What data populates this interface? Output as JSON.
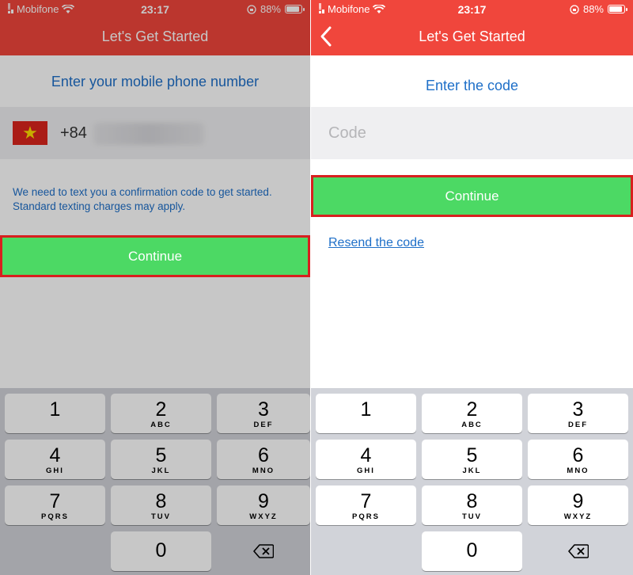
{
  "status": {
    "carrier": "Mobifone",
    "time": "23:17",
    "battery_percent": "88%",
    "battery_level": 0.88
  },
  "left": {
    "title": "Let's Get Started",
    "prompt": "Enter your mobile phone number",
    "country_code": "+84",
    "info_line1": "We need to text you a confirmation code to get started.",
    "info_line2": "Standard texting charges may apply.",
    "continue_label": "Continue"
  },
  "right": {
    "title": "Let's Get Started",
    "prompt": "Enter the code",
    "code_placeholder": "Code",
    "continue_label": "Continue",
    "resend_label": "Resend the code"
  },
  "keypad": {
    "keys": [
      {
        "num": "1",
        "letters": ""
      },
      {
        "num": "2",
        "letters": "ABC"
      },
      {
        "num": "3",
        "letters": "DEF"
      },
      {
        "num": "4",
        "letters": "GHI"
      },
      {
        "num": "5",
        "letters": "JKL"
      },
      {
        "num": "6",
        "letters": "MNO"
      },
      {
        "num": "7",
        "letters": "PQRS"
      },
      {
        "num": "8",
        "letters": "TUV"
      },
      {
        "num": "9",
        "letters": "WXYZ"
      },
      {
        "num": "0",
        "letters": ""
      }
    ]
  },
  "colors": {
    "header": "#f0463c",
    "accent_blue": "#1e6fc8",
    "continue_green": "#4cd964",
    "highlight_red": "#d81f1f"
  },
  "icons": {
    "signal": "signal-icon",
    "wifi": "wifi-icon",
    "lock": "orientation-lock-icon",
    "battery": "battery-icon",
    "back": "chevron-left-icon",
    "flag": "vietnam-flag-icon",
    "delete": "backspace-icon"
  }
}
